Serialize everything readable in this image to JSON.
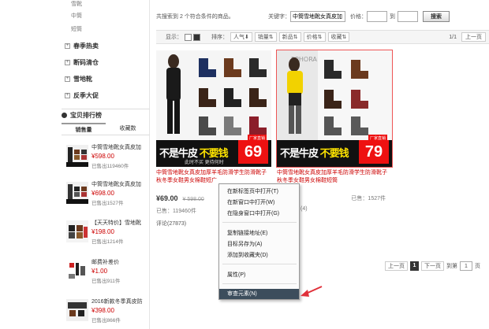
{
  "sidebar": {
    "sub_items": [
      "雪靴",
      "中筒",
      "短筒"
    ],
    "categories": [
      "春季热卖",
      "断码清仓",
      "雪地靴",
      "反季大促"
    ],
    "rank_title": "宝贝排行榜",
    "rank_tabs": [
      "销售量",
      "收藏数"
    ],
    "rank_items": [
      {
        "name": "中筒雪地靴女真皮加",
        "price": "¥598.00",
        "sold": "已售出119460件"
      },
      {
        "name": "中筒雪地靴女真皮加",
        "price": "¥698.00",
        "sold": "已售出1527件"
      },
      {
        "name": "【天天特价】雪地靴",
        "price": "¥198.00",
        "sold": "已售出1214件"
      },
      {
        "name": "邮费补差价",
        "price": "¥1.00",
        "sold": "已售出911件"
      },
      {
        "name": "2016新款冬季真皮防",
        "price": "¥398.00",
        "sold": "已售出866件"
      }
    ]
  },
  "topbar": {
    "summary": "共搜索到 2 个符合条件的商品。",
    "keyword_label": "关键字：",
    "keyword_value": "中筒雪地靴女真皮加",
    "price_label": "价格：",
    "to_label": "到",
    "search_label": "搜索"
  },
  "sortbar": {
    "display_label": "显示：",
    "sort_label": "排序：",
    "options": [
      "人气",
      "销量",
      "新品",
      "价格",
      "收藏"
    ],
    "page_info": "1/1",
    "prev_label": "上一页"
  },
  "products": [
    {
      "title": "中筒雪地靴女真皮加厚羊毛防滑学生防滑靴子秋冬季女鞋男女棉鞋短广",
      "price": "¥69.00",
      "old_price": "¥ 598.00",
      "sold": "已售：119460件",
      "review": "评论(27873)",
      "banner_a": "不是牛皮",
      "banner_b": "不要钱",
      "banner_sub": "此时不买 更待何时",
      "badge": "69",
      "badge_label": "厂家直销"
    },
    {
      "title": "中筒雪地靴女真皮加厚羊毛防滑学生防滑靴子秋冬季女鞋男女棉鞋短筒",
      "price": "",
      "old_price": "",
      "sold": "已售：1527件",
      "review": "(4)",
      "banner_a": "不是牛皮",
      "banner_b": "不要钱",
      "banner_sub": "",
      "badge": "79",
      "badge_label": "厂家直销"
    }
  ],
  "context_menu": {
    "items": [
      "在新标签页中打开(T)",
      "在新窗口中打开(W)",
      "在隐身窗口中打开(G)",
      "复制链接地址(E)",
      "目标另存为(A)",
      "添加到收藏夹(D)",
      "属性(P)",
      "审查元素(N)"
    ]
  },
  "pager": {
    "prev": "上一页",
    "current": "1",
    "next": "下一页",
    "goto": "到第",
    "page_value": "1",
    "page_unit": "页"
  },
  "colors": {
    "price_red": "#cc0000",
    "menu_highlight": "#3c4d5c",
    "arrow_red": "#e0303a"
  }
}
